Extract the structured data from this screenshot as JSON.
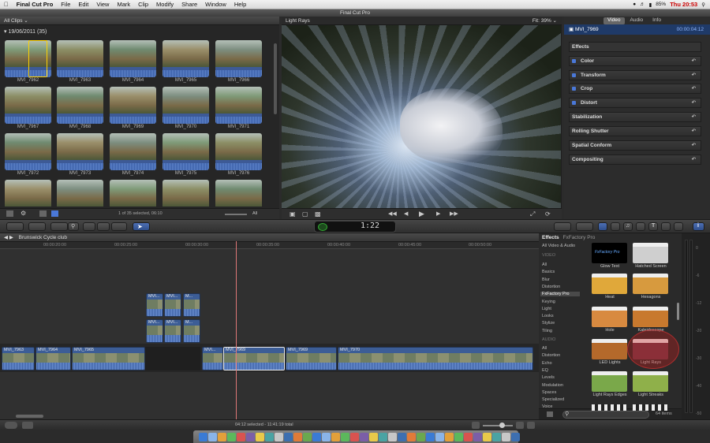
{
  "menubar": {
    "app": "Final Cut Pro",
    "items": [
      "File",
      "Edit",
      "View",
      "Mark",
      "Clip",
      "Modify",
      "Share",
      "Window",
      "Help"
    ],
    "clock": "Thu 20:53",
    "battery": "85%"
  },
  "window_title": "Final Cut Pro",
  "browser": {
    "tab": "All Clips",
    "date_group": "19/06/2011",
    "count": "(35)",
    "clips": [
      "MVI_7962",
      "MVI_7963",
      "MVI_7964",
      "MVI_7965",
      "MVI_7966",
      "MVI_7967",
      "MVI_7968",
      "MVI_7969",
      "MVI_7970",
      "MVI_7971",
      "MVI_7972",
      "MVI_7973",
      "MVI_7974",
      "MVI_7975",
      "MVI_7976",
      "",
      "",
      "",
      "",
      ""
    ],
    "status": "1 of 35 selected, 06:10",
    "filter": "All"
  },
  "viewer": {
    "title": "Light Rays",
    "fit_label": "Fit:",
    "zoom": "39%"
  },
  "inspector": {
    "tabs": [
      "Video",
      "Audio",
      "Info"
    ],
    "clip_name": "MVI_7969",
    "timecode": "00:00:04:12",
    "effects_label": "Effects",
    "rows": [
      {
        "label": "Color",
        "check": true
      },
      {
        "label": "Transform",
        "check": true
      },
      {
        "label": "Crop",
        "check": true
      },
      {
        "label": "Distort",
        "check": true
      },
      {
        "label": "Stabilization",
        "check": false
      },
      {
        "label": "Rolling Shutter",
        "check": false
      },
      {
        "label": "Spatial Conform",
        "check": false
      },
      {
        "label": "Compositing",
        "check": false
      }
    ]
  },
  "timecode_display": "1:22",
  "timeline": {
    "project": "Brunswick Cycle club",
    "ruler": [
      "00:00:20:00",
      "00:00:25:00",
      "00:00:30:00",
      "00:00:35:00",
      "00:00:40:00",
      "00:00:45:00",
      "00:00:50:00"
    ],
    "primary_clips": [
      "MVI_7963",
      "MVI_7964",
      "MVI_7965",
      "MVI...",
      "MVI_7969",
      "MVI_7969",
      "MVI_7970"
    ],
    "connected_clips": [
      "MVI...",
      "MVI...",
      "M..."
    ],
    "status": "04:12 selected - 11:41:19 total"
  },
  "effects_browser": {
    "title": "Effects",
    "subtitle": "FxFactory Pro",
    "video_header": "VIDEO",
    "video_cats": [
      "All",
      "Basics",
      "Blur",
      "Distortion",
      "FxFactory Pro",
      "Keying",
      "Light",
      "Looks",
      "Stylize",
      "Tiling"
    ],
    "audio_header": "AUDIO",
    "audio_cats": [
      "All",
      "Distortion",
      "Echo",
      "EQ",
      "Levels",
      "Modulation",
      "Spaces",
      "Specialized",
      "Voice"
    ],
    "all_label": "All Video & Audio",
    "effects": [
      "Glow Text",
      "Hatched Screen",
      "Heat",
      "Hexagons",
      "Hole",
      "Kaleidoscope",
      "LED Lights",
      "Light Rays",
      "Light Rays Edges",
      "Light Streaks"
    ],
    "count": "64 items"
  },
  "meter_ticks": [
    "0",
    "-6",
    "-12",
    "-20",
    "-30",
    "-40",
    "-50"
  ]
}
